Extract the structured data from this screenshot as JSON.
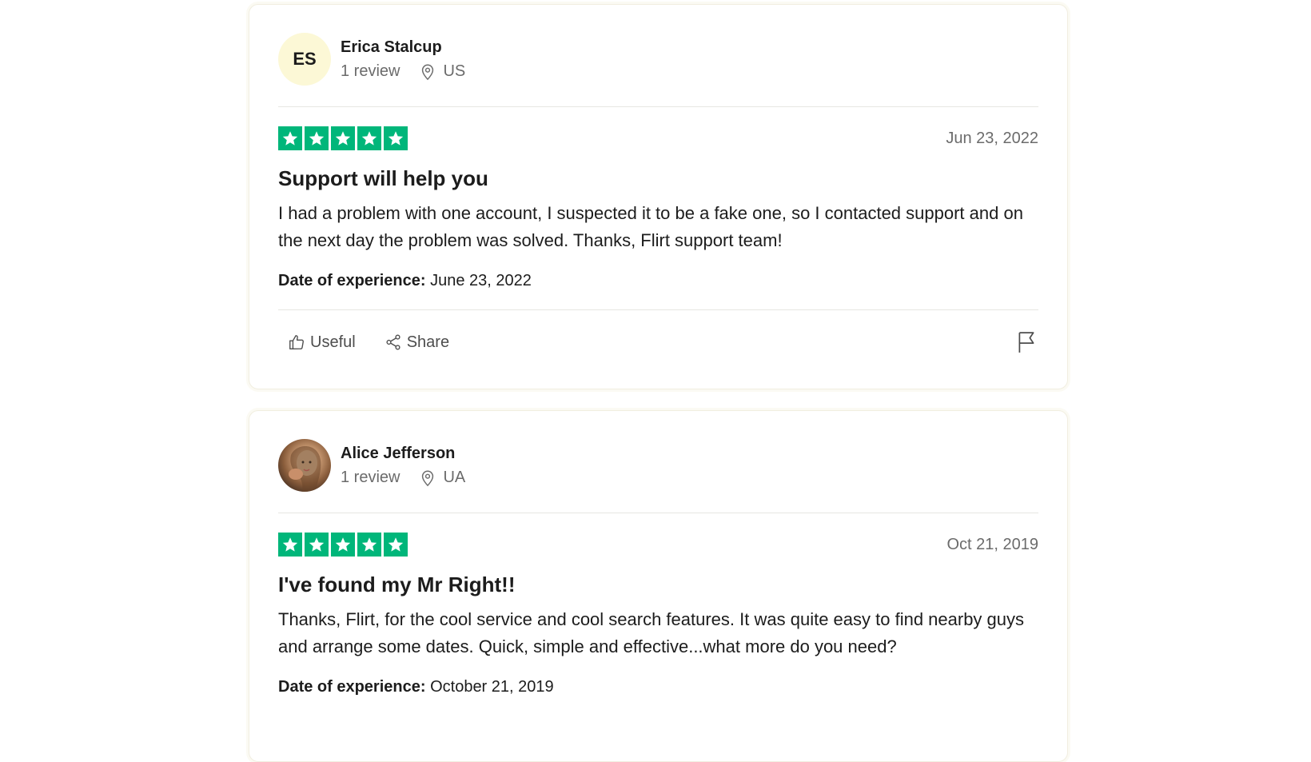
{
  "colors": {
    "star_green": "#00b67a",
    "initials_avatar_bg": "#fcf8d6",
    "muted_text": "#6b6b6b"
  },
  "reviews": [
    {
      "avatar_initials": "ES",
      "name": "Erica Stalcup",
      "review_count": "1 review",
      "country": "US",
      "rating": 5,
      "date": "Jun 23, 2022",
      "title": "Support will help you",
      "body": "I had a problem with one account, I suspected it to be a fake one, so I contacted support and on the next day the problem was solved. Thanks, Flirt support team!",
      "experience_label": "Date of experience:",
      "experience_date": "June 23, 2022",
      "useful_label": "Useful",
      "share_label": "Share"
    },
    {
      "avatar_type": "photo",
      "name": "Alice Jefferson",
      "review_count": "1 review",
      "country": "UA",
      "rating": 5,
      "date": "Oct 21, 2019",
      "title": "I've found my Mr Right!!",
      "body": "Thanks, Flirt, for the cool service and cool search features. It was quite easy to find nearby guys and arrange some dates. Quick, simple and effective...what more do you need?",
      "experience_label": "Date of experience:",
      "experience_date": "October 21, 2019"
    }
  ]
}
